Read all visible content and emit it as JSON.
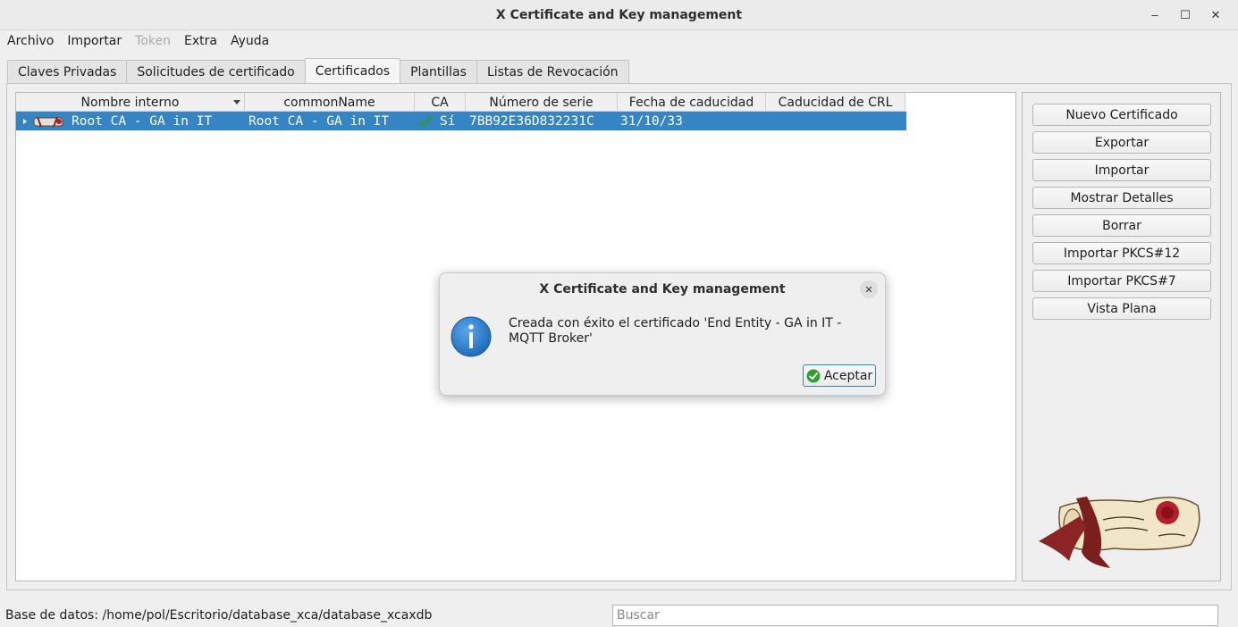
{
  "window": {
    "title": "X Certificate and Key management",
    "controls": [
      "‒",
      "☐",
      "✕"
    ]
  },
  "menu": [
    "Archivo",
    "Importar",
    "Token",
    "Extra",
    "Ayuda"
  ],
  "tabs": [
    "Claves Privadas",
    "Solicitudes de certificado",
    "Certificados",
    "Plantillas",
    "Listas de Revocación"
  ],
  "table": {
    "columns": [
      "Nombre interno",
      "commonName",
      "CA",
      "Número de serie",
      "Fecha de caducidad",
      "Caducidad de CRL"
    ],
    "rows": [
      {
        "internal_name": "Root CA - GA in IT",
        "common_name": "Root CA - GA in IT",
        "ca": "Sí",
        "serial": "7BB92E36D832231C",
        "expiry": "31/10/33",
        "crl_expiry": ""
      }
    ]
  },
  "buttons": [
    "Nuevo Certificado",
    "Exportar",
    "Importar",
    "Mostrar Detalles",
    "Borrar",
    "Importar PKCS#12",
    "Importar PKCS#7",
    "Vista Plana"
  ],
  "status": {
    "db_path": "Base de datos: /home/pol/Escritorio/database_xca/database_xcaxdb",
    "search_placeholder": "Buscar"
  },
  "dialog": {
    "title": "X Certificate and Key management",
    "message": "Creada con éxito el certificado 'End Entity - GA in IT - MQTT Broker'",
    "ok_label": "Aceptar",
    "icon": "info-icon"
  },
  "colors": {
    "selection": "#3584c4",
    "info": "#2f7fd0",
    "check": "#2e9e2e"
  }
}
